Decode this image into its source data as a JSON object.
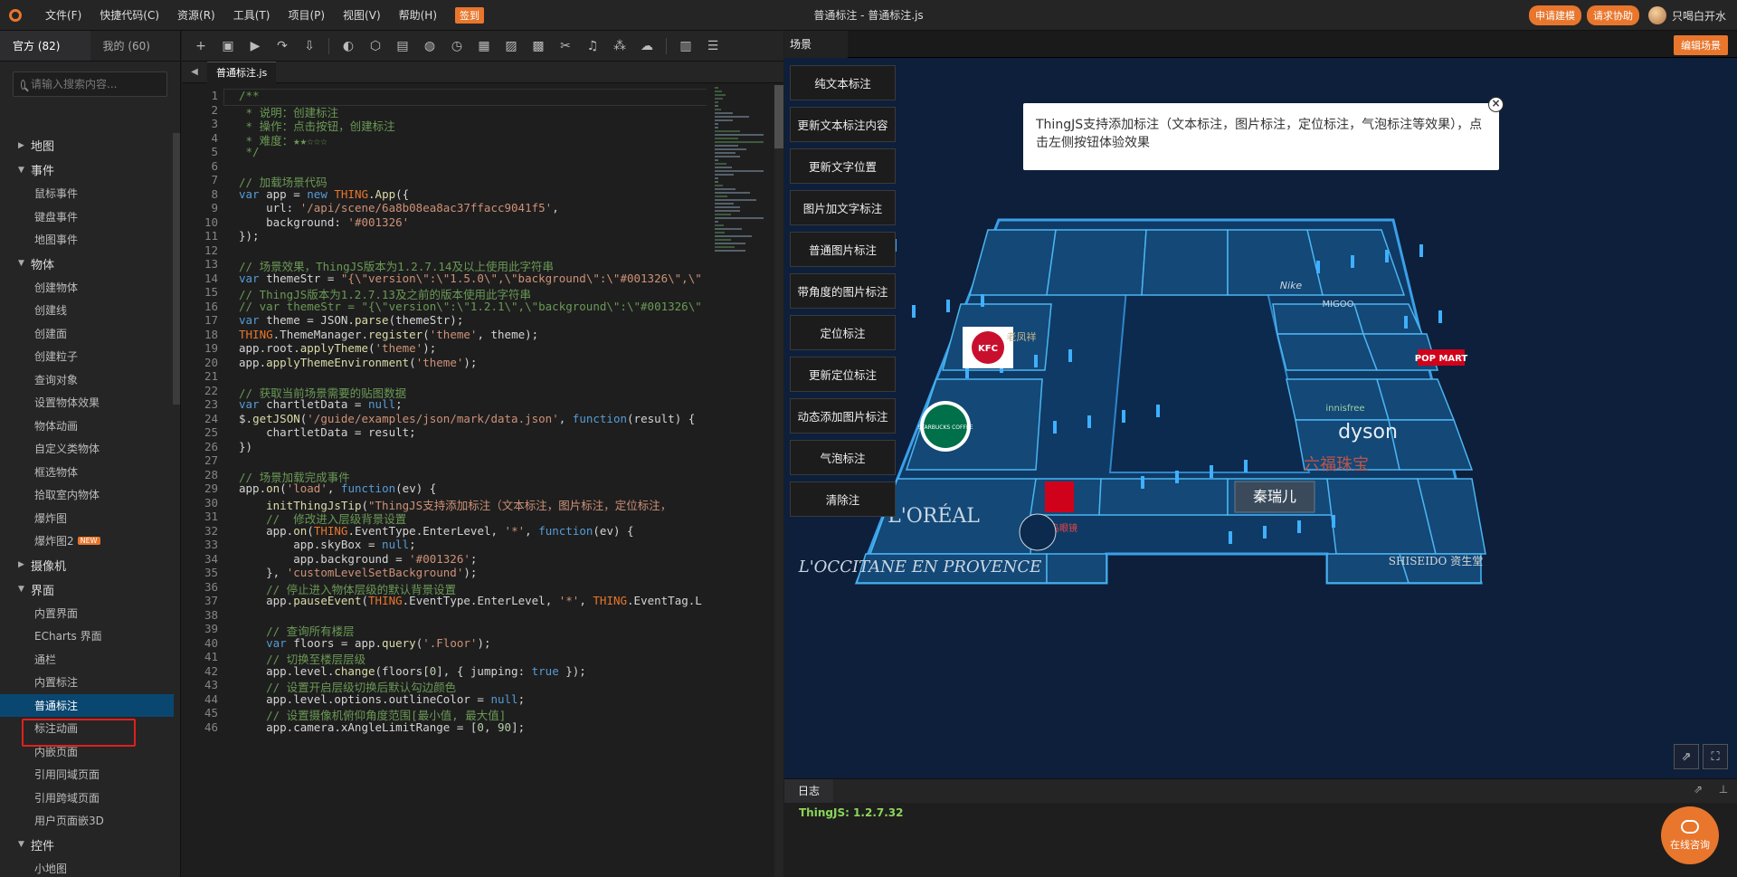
{
  "app": {
    "title": "普通标注 - 普通标注.js",
    "menu": [
      "文件(F)",
      "快捷代码(C)",
      "资源(R)",
      "工具(T)",
      "项目(P)",
      "视图(V)",
      "帮助(H)"
    ],
    "signin": "签到",
    "top_right": {
      "apply_model": "申请建模",
      "request_help": "请求协助",
      "username": "只喝白开水"
    }
  },
  "sidebar": {
    "tabs": [
      {
        "label": "官方 (82)",
        "active": true
      },
      {
        "label": "我的 (60)",
        "active": false
      }
    ],
    "search_placeholder": "请输入搜索内容...",
    "tree": [
      {
        "type": "cat",
        "label": "地图",
        "open": false
      },
      {
        "type": "cat",
        "label": "事件",
        "open": true
      },
      {
        "type": "item",
        "label": "鼠标事件"
      },
      {
        "type": "item",
        "label": "键盘事件"
      },
      {
        "type": "item",
        "label": "地图事件"
      },
      {
        "type": "cat",
        "label": "物体",
        "open": true
      },
      {
        "type": "item",
        "label": "创建物体"
      },
      {
        "type": "item",
        "label": "创建线"
      },
      {
        "type": "item",
        "label": "创建面"
      },
      {
        "type": "item",
        "label": "创建粒子"
      },
      {
        "type": "item",
        "label": "查询对象"
      },
      {
        "type": "item",
        "label": "设置物体效果"
      },
      {
        "type": "item",
        "label": "物体动画"
      },
      {
        "type": "item",
        "label": "自定义类物体"
      },
      {
        "type": "item",
        "label": "框选物体"
      },
      {
        "type": "item",
        "label": "拾取室内物体"
      },
      {
        "type": "item",
        "label": "爆炸图"
      },
      {
        "type": "item",
        "label": "爆炸图2",
        "badge": "NEW"
      },
      {
        "type": "cat",
        "label": "摄像机",
        "open": false
      },
      {
        "type": "cat",
        "label": "界面",
        "open": true
      },
      {
        "type": "item",
        "label": "内置界面"
      },
      {
        "type": "item",
        "label": "ECharts 界面"
      },
      {
        "type": "item",
        "label": "通栏"
      },
      {
        "type": "item",
        "label": "内置标注"
      },
      {
        "type": "item",
        "label": "普通标注",
        "selected": true
      },
      {
        "type": "item",
        "label": "标注动画"
      },
      {
        "type": "item",
        "label": "内嵌页面"
      },
      {
        "type": "item",
        "label": "引用同域页面"
      },
      {
        "type": "item",
        "label": "引用跨域页面"
      },
      {
        "type": "item",
        "label": "用户页面嵌3D"
      },
      {
        "type": "cat",
        "label": "控件",
        "open": true
      },
      {
        "type": "item",
        "label": "小地图"
      }
    ]
  },
  "editor": {
    "file_tab": "普通标注.js",
    "toolbar_icons": [
      "add-icon",
      "save-icon",
      "run-icon",
      "share-icon",
      "download-icon",
      "theme-icon",
      "cube-icon",
      "building-icon",
      "globe-icon",
      "clock-icon",
      "grid-icon",
      "image-icon",
      "picture-icon",
      "tools-icon",
      "music-icon",
      "cluster-icon",
      "cloud-icon",
      "book-icon",
      "settings-icon"
    ],
    "lines": [
      "/**",
      " * 说明：创建标注",
      " * 操作：点击按钮，创建标注",
      " * 难度：★★☆☆☆",
      " */",
      "",
      "// 加载场景代码",
      "var app = new THING.App({",
      "    url: '/api/scene/6a8b08ea8ac37ffacc9041f5',",
      "    background: '#001326'",
      "});",
      "",
      "// 场景效果，ThingJS版本为1.2.7.14及以上使用此字符串",
      "var themeStr = \"{\\\"version\\\":\\\"1.5.0\\\",\\\"background\\\":\\\"#001326\\\",\\\"",
      "// ThingJS版本为1.2.7.13及之前的版本使用此字符串",
      "// var themeStr = \"{\\\"version\\\":\\\"1.2.1\\\",\\\"background\\\":\\\"#001326\\\"",
      "var theme = JSON.parse(themeStr);",
      "THING.ThemeManager.register('theme', theme);",
      "app.root.applyTheme('theme');",
      "app.applyThemeEnvironment('theme');",
      "",
      "// 获取当前场景需要的贴图数据",
      "var chartletData = null;",
      "$.getJSON('/guide/examples/json/mark/data.json', function(result) {",
      "    chartletData = result;",
      "})",
      "",
      "// 场景加载完成事件",
      "app.on('load', function(ev) {",
      "    initThingJsTip(\"ThingJS支持添加标注（文本标注，图片标注，定位标注，",
      "    //  修改进入层级背景设置",
      "    app.on(THING.EventType.EnterLevel, '*', function(ev) {",
      "        app.skyBox = null;",
      "        app.background = '#001326';",
      "    }, 'customLevelSetBackground');",
      "    // 停止进入物体层级的默认背景设置",
      "    app.pauseEvent(THING.EventType.EnterLevel, '*', THING.EventTag.L",
      "",
      "    // 查询所有楼层",
      "    var floors = app.query('.Floor');",
      "    // 切换至楼层层级",
      "    app.level.change(floors[0], { jumping: true });",
      "    // 设置开启层级切换后默认勾边颜色",
      "    app.level.options.outlineColor = null;",
      "    // 设置摄像机俯仰角度范围[最小值, 最大值]",
      "    app.camera.xAngleLimitRange = [0, 90];"
    ]
  },
  "scene": {
    "tab": "场景",
    "edit_button": "编辑场景",
    "buttons": [
      "纯文本标注",
      "更新文本标注内容",
      "更新文字位置",
      "图片加文字标注",
      "普通图片标注",
      "带角度的图片标注",
      "定位标注",
      "更新定位标注",
      "动态添加图片标注",
      "气泡标注",
      "清除注"
    ],
    "tip": "ThingJS支持添加标注（文本标注，图片标注，定位标注，气泡标注等效果），点击左侧按钮体验效果",
    "tip_close": "×",
    "shops": [
      "KFC",
      "STARBUCKS COFFEE",
      "L'ORÉAL",
      "L'OCCITANE EN PROVENCE",
      "dyson",
      "POP MART",
      "innisfree",
      "SHISEIDO 资生堂",
      "六福珠宝",
      "秦瑞儿",
      "宝岛眼镜",
      "老凤祥",
      "Nike",
      "MIGOO"
    ]
  },
  "log": {
    "tab": "日志",
    "text": "ThingJS: 1.2.7.32",
    "consult": "在线咨询"
  }
}
